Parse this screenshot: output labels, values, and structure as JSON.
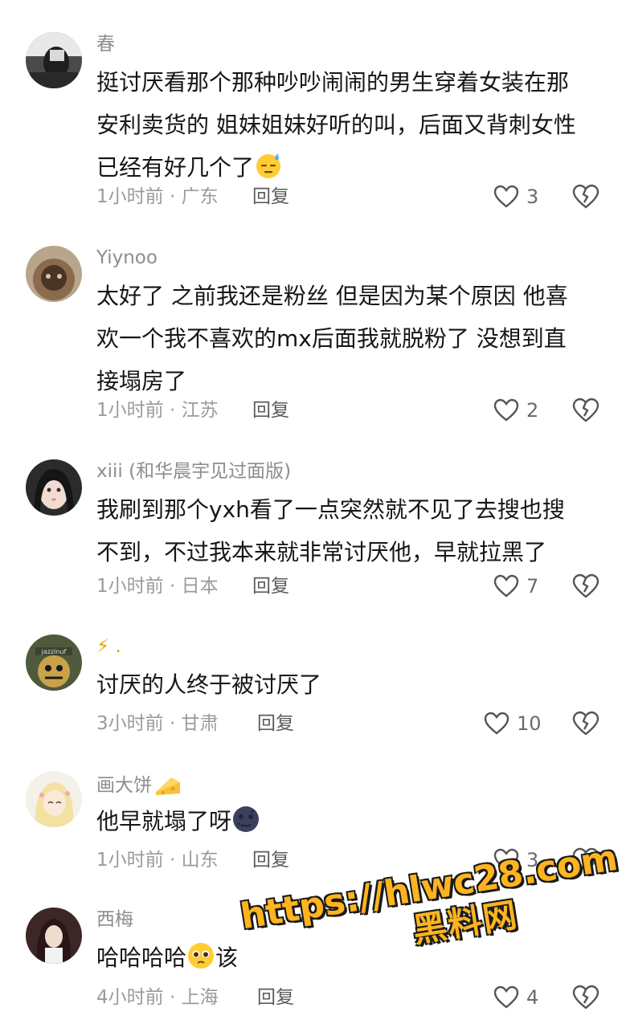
{
  "reply_label": "回复",
  "watermark": {
    "url": "https://hlwc28.com",
    "name": "黑料网"
  },
  "comments": [
    {
      "username": "春",
      "lines": [
        "挺讨厌看那个那种吵吵闹闹的男生穿着女装在那",
        "安利卖货的 姐妹姐妹好听的叫，后面又背刺女性",
        "已经有好几个了"
      ],
      "emoji": "downcast-sweat-face",
      "time_location": "1小时前 · 广东",
      "likes": "3"
    },
    {
      "username": "Yiynoo",
      "lines": [
        "太好了 之前我还是粉丝 但是因为某个原因 他喜",
        "欢一个我不喜欢的mx后面我就脱粉了 没想到直",
        "接塌房了"
      ],
      "time_location": "1小时前 · 江苏",
      "likes": "2"
    },
    {
      "username": "xiii (和华晨宇见过面版)",
      "lines": [
        "我刷到那个yxh看了一点突然就不见了去搜也搜",
        "不到，不过我本来就非常讨厌他，早就拉黑了"
      ],
      "time_location": "1小时前 · 日本",
      "likes": "7"
    },
    {
      "username": "⚡ .",
      "lines": [
        "讨厌的人终于被讨厌了"
      ],
      "time_location": "3小时前 · 甘肃",
      "likes": "10"
    },
    {
      "username": "画大饼",
      "username_emoji": "cheese",
      "lines": [
        "他早就塌了呀"
      ],
      "emoji": "new-moon-face",
      "time_location": "1小时前 · 山东",
      "likes": "3"
    },
    {
      "username": "西梅",
      "lines": [
        "哈哈哈哈"
      ],
      "emoji": "pleading-face",
      "line_suffix": "该",
      "time_location": "4小时前 · 上海",
      "likes": "4"
    }
  ]
}
